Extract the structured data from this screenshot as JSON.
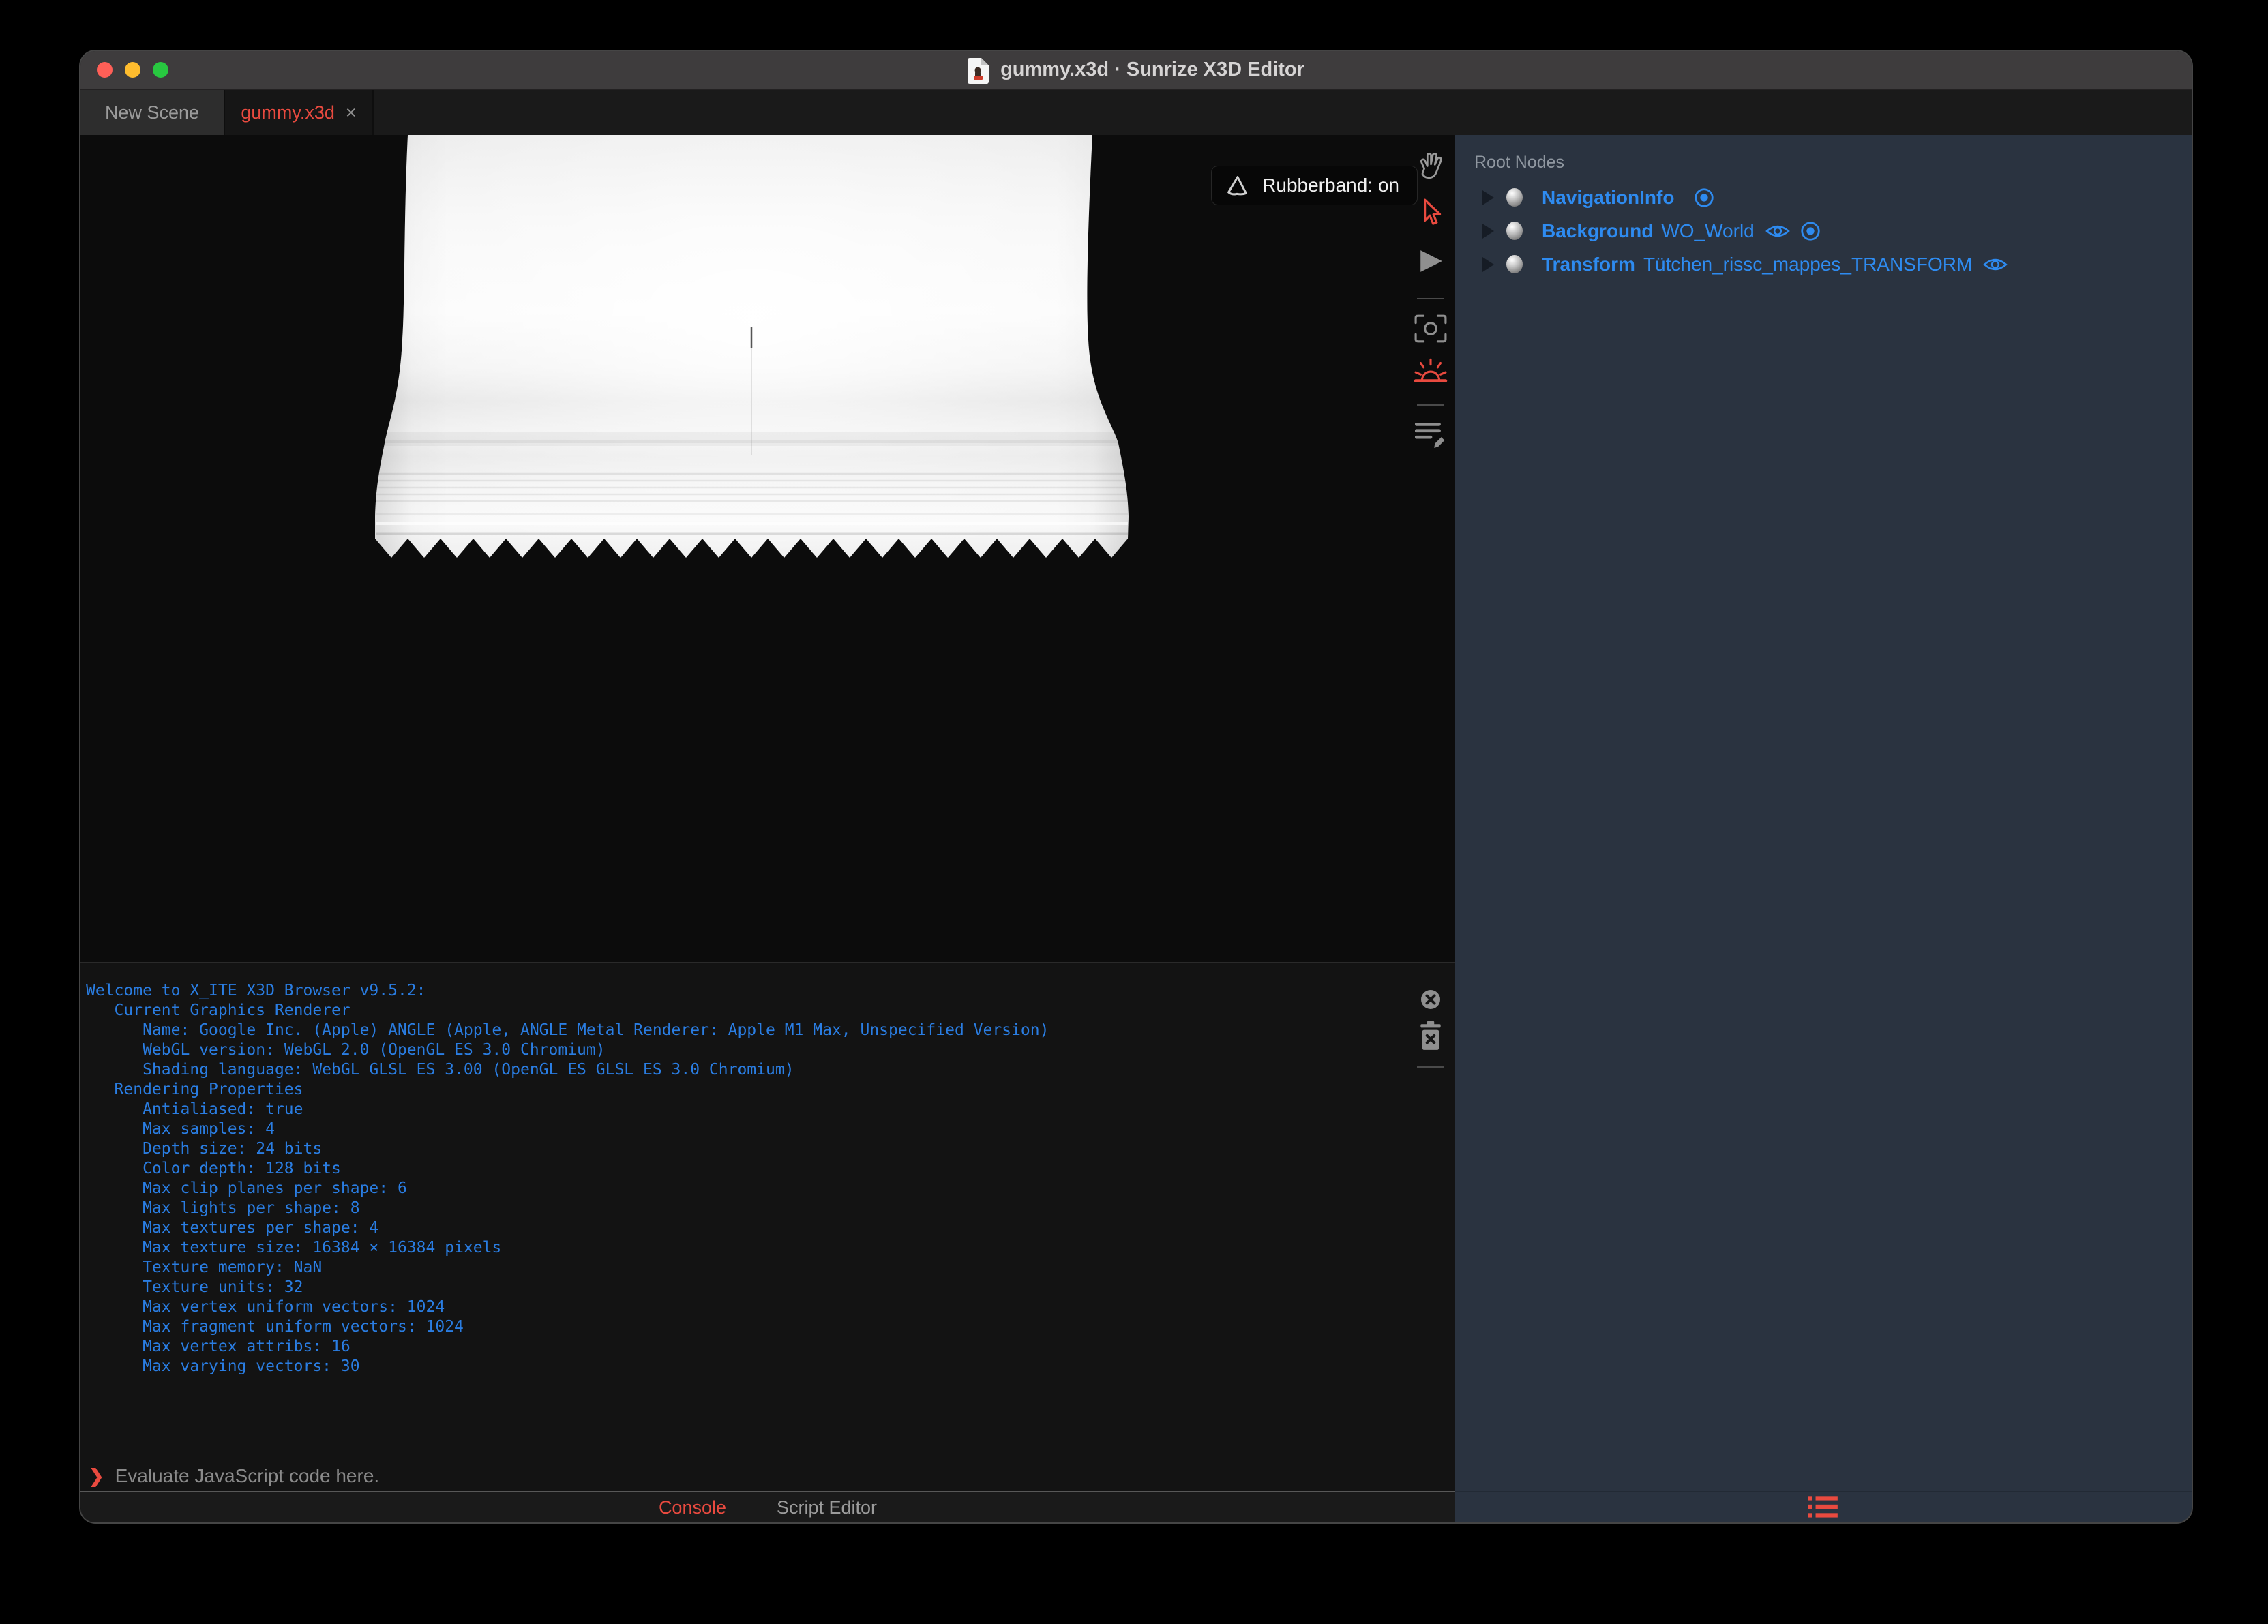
{
  "window": {
    "title": "gummy.x3d · Sunrize X3D Editor"
  },
  "traffic_lights": {
    "close": "#ff5f57",
    "minimize": "#febc2e",
    "zoom": "#28c840"
  },
  "tabs": [
    {
      "label": "New Scene",
      "active": false
    },
    {
      "label": "gummy.x3d",
      "active": true,
      "close_label": "×"
    }
  ],
  "viewport": {
    "rubberband_label": "Rubberband: on"
  },
  "toolbar": {
    "tools": [
      {
        "name": "pan-hand",
        "active": false
      },
      {
        "name": "select-arrow",
        "active": true
      },
      {
        "name": "play",
        "active": false
      },
      {
        "name": "center-view",
        "active": false
      },
      {
        "name": "sunrise-light",
        "active": true
      },
      {
        "name": "script-edit",
        "active": false
      }
    ],
    "console_tools": [
      {
        "name": "close-circle"
      },
      {
        "name": "clear-trash"
      }
    ]
  },
  "sidebar": {
    "header": "Root Nodes",
    "nodes": [
      {
        "type": "NavigationInfo",
        "name": "",
        "icons": [
          "bind"
        ]
      },
      {
        "type": "Background",
        "name": "WO_World",
        "icons": [
          "eye",
          "bind"
        ]
      },
      {
        "type": "Transform",
        "name": "Tütchen_rissc_mappes_TRANSFORM",
        "icons": [
          "eye"
        ]
      }
    ]
  },
  "console": {
    "lines": [
      "Welcome to X_ITE X3D Browser v9.5.2:",
      "   Current Graphics Renderer",
      "      Name: Google Inc. (Apple) ANGLE (Apple, ANGLE Metal Renderer: Apple M1 Max, Unspecified Version)",
      "      WebGL version: WebGL 2.0 (OpenGL ES 3.0 Chromium)",
      "      Shading language: WebGL GLSL ES 3.00 (OpenGL ES GLSL ES 3.0 Chromium)",
      "   Rendering Properties",
      "      Antialiased: true",
      "      Max samples: 4",
      "      Depth size: 24 bits",
      "      Color depth: 128 bits",
      "      Max clip planes per shape: 6",
      "      Max lights per shape: 8",
      "      Max textures per shape: 4",
      "      Max texture size: 16384 × 16384 pixels",
      "      Texture memory: NaN",
      "      Texture units: 32",
      "      Max vertex uniform vectors: 1024",
      "      Max fragment uniform vectors: 1024",
      "      Max vertex attribs: 16",
      "      Max varying vectors: 30"
    ]
  },
  "prompt": {
    "symbol": "❯",
    "placeholder": "Evaluate JavaScript code here."
  },
  "bottom_tabs": [
    {
      "label": "Console",
      "active": true
    },
    {
      "label": "Script Editor",
      "active": false
    }
  ],
  "colors": {
    "accent_red": "#e94a3f",
    "node_blue": "#2e8bf0",
    "console_blue": "#2a7de2",
    "sidebar_bg": "#2a3340",
    "titlebar_bg": "#3e3c3d",
    "viewport_bg": "#0c0c0c"
  }
}
